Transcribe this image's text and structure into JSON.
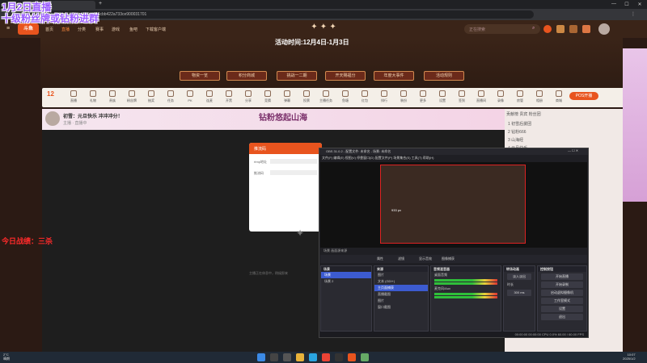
{
  "browser": {
    "tab_title": "斗鱼直播",
    "url": "douyu.com/topic/...?id=4655(9754cbb422a733ce900031701",
    "new_tab": "+"
  },
  "site": {
    "logo": "斗鱼",
    "nav": [
      "首页",
      "直播",
      "分类",
      "赛事",
      "游戏",
      "鱼吧",
      "下载客户端"
    ],
    "search_placeholder": "正在搜索"
  },
  "overlays": {
    "line1": "1月2日直播",
    "line2": "十级粉丝牌或钻粉进群",
    "line3": "今日战绩：三杀"
  },
  "event": {
    "time": "活动时间:12月4日-1月3日",
    "buttons": [
      "物资一览",
      "积分商城",
      "挑战一二期",
      "开天赐福分",
      "年度大事件",
      "活动规则"
    ]
  },
  "toolstrip": {
    "level": "12",
    "tools": [
      "直播",
      "礼物",
      "贵族",
      "粉丝牌",
      "抽奖",
      "任务",
      "PK",
      "连麦",
      "开黑",
      "分享",
      "竞猜",
      "弹幕",
      "投票",
      "主播任务",
      "鱼塘",
      "红包",
      "排行",
      "装扮",
      "更多",
      "设置",
      "签到",
      "直播间",
      "录像",
      "房管",
      "相册",
      "商城"
    ],
    "pos_button": "POS开播"
  },
  "room": {
    "title": "初雪：元旦快乐 冲冲冲分！",
    "streamer": "主播 · 直播中",
    "banner_text": "钻粉悠起山海"
  },
  "stream_card": {
    "header": "推流码",
    "rtmp_label": "rtmp地址",
    "stream_label": "推流码",
    "no_video": "主播正在休息中，稍候即来"
  },
  "right_panel": {
    "tabs": "贡献榜  贵宾  粉丝团",
    "ranks": [
      "1 初雪后援团",
      "2 钻粉666",
      "3 山海经",
      "4 元旦快乐",
      "5 冲冲冲"
    ]
  },
  "obs": {
    "title": "OBS 31.0.2 - 配置文件: 未命名 - 场景: 未命名",
    "menu": "文件(F)  编辑(E)  视图(V)  停靠窗口(D)  配置文件(P)  场景集合(S)  工具(T)  帮助(H)",
    "preview_badge": "933 px",
    "scene_bar": "场景    画面源来源",
    "controls": [
      "属性",
      "滤镜",
      "显示音效",
      "图像捕获"
    ],
    "scenes_header": "场景",
    "scenes": [
      "场景",
      "场景 2"
    ],
    "sources_header": "来源",
    "sources": [
      "图片",
      "文本 (GDI+)",
      "主页面捕获",
      "直播截图",
      "图片",
      "窗口截图"
    ],
    "audio_header": "音频混音器",
    "audio_tracks": [
      "桌面音频",
      "麦克风/Aux"
    ],
    "transition_header": "转场动画",
    "transition_mode": "淡入淡出",
    "duration_label": "时长",
    "duration_value": "300 ms",
    "controls_header": "控制按钮",
    "buttons": [
      "开始直播",
      "开始录制",
      "启动虚拟摄像机",
      "工作室模式",
      "设置",
      "退出"
    ],
    "status": "00:00:00   00:00:00   CPU 0.0%   60.00 / 60.00 FPS"
  },
  "taskbar": {
    "weather_temp": "2°C",
    "weather_desc": "晴朗",
    "time": "10:07",
    "date": "2025/1/2"
  }
}
